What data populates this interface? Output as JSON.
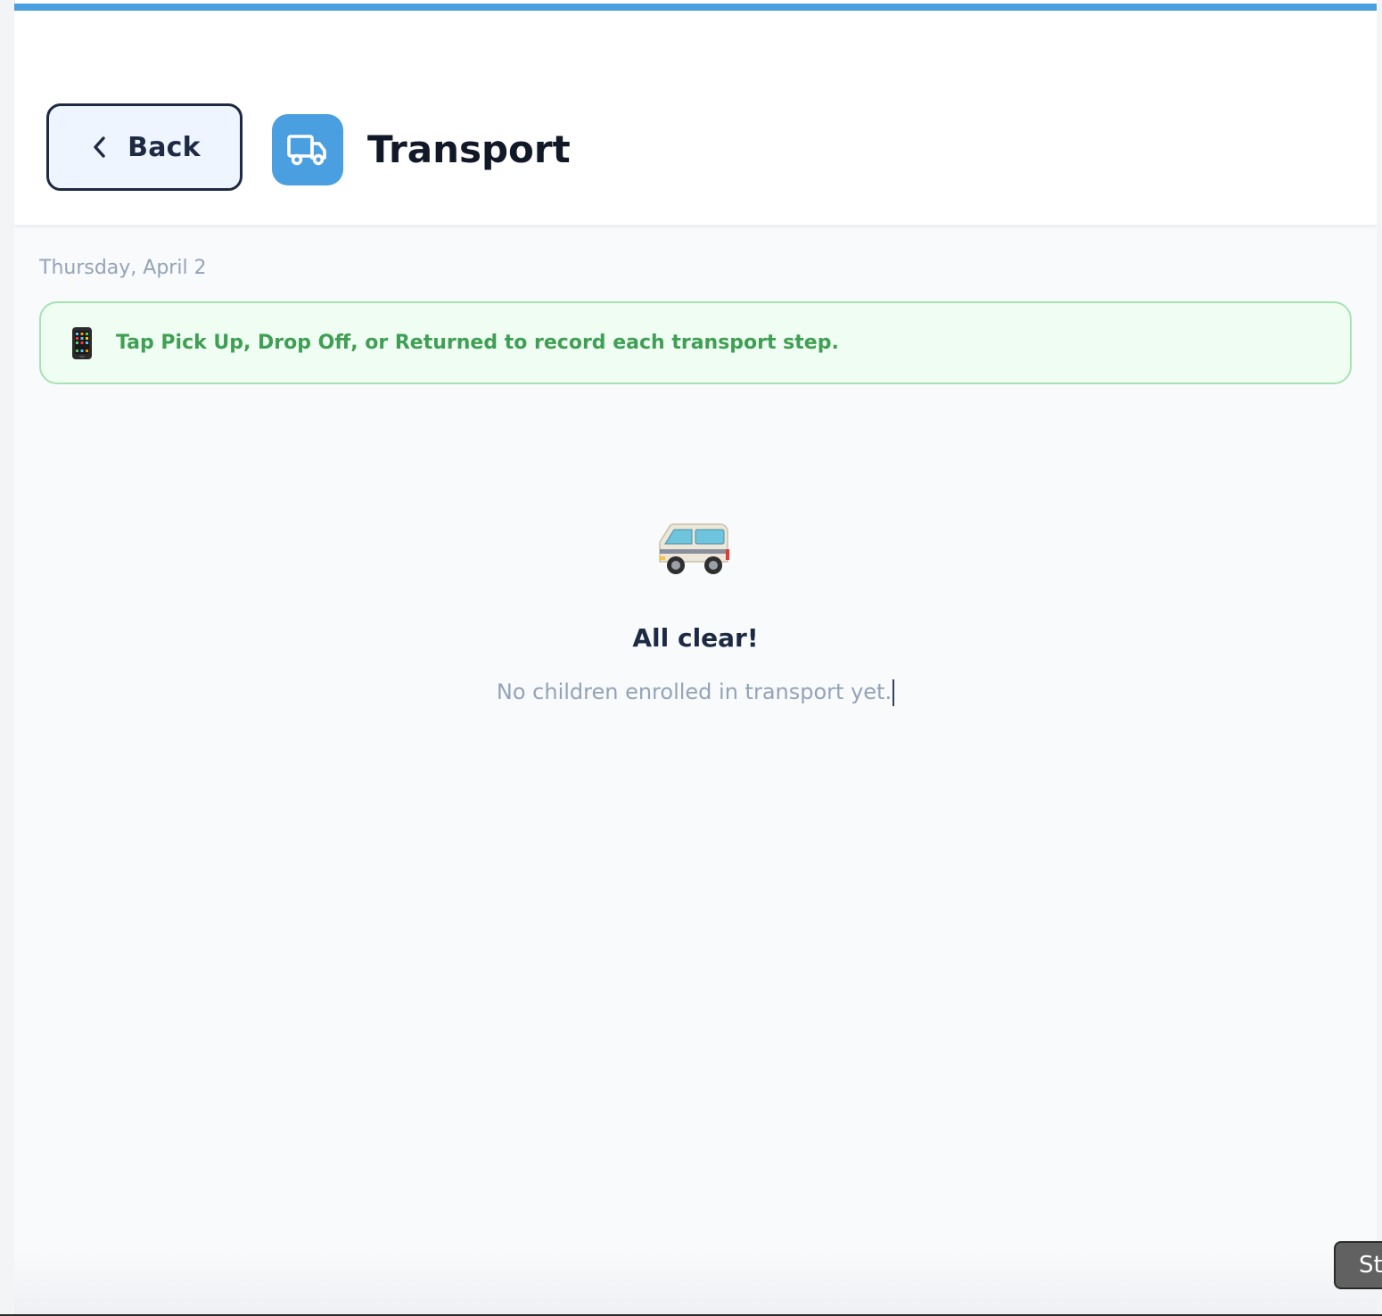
{
  "colors": {
    "accent": "#4a9fe0",
    "back_border": "#1e2a44",
    "banner_border": "#a6e3b3",
    "banner_bg": "#f0fdf3",
    "banner_text": "#3f9f54",
    "muted_text": "#94a3b8"
  },
  "header": {
    "back_label": "Back",
    "back_icon": "chevron-left-icon",
    "app_icon": "truck-icon",
    "title": "Transport"
  },
  "main": {
    "date": "Thursday, April 2",
    "banner": {
      "icon": "mobile-phone-icon",
      "text": "Tap Pick Up, Drop Off, or Returned to record each transport step."
    },
    "empty_state": {
      "icon": "van-icon",
      "title": "All clear!",
      "subtitle": "No children enrolled in transport yet."
    }
  },
  "floating": {
    "label": "St"
  }
}
